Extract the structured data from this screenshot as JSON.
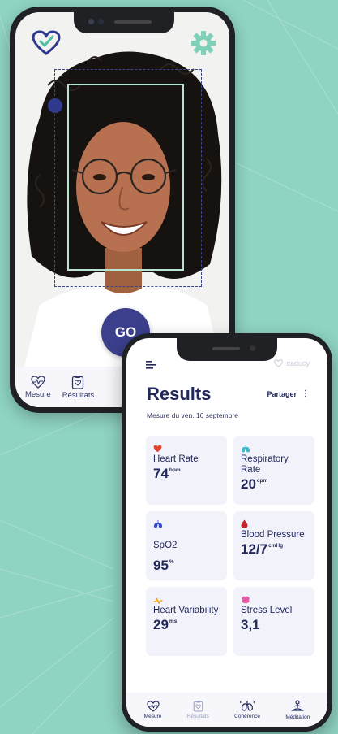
{
  "camera_screen": {
    "go_label": "GO",
    "nav": [
      {
        "label": "Mesure",
        "icon": "heart-pulse-icon"
      },
      {
        "label": "Résultats",
        "icon": "clipboard-heart-icon"
      }
    ]
  },
  "results_screen": {
    "brand": "caducy",
    "title": "Results",
    "share_label": "Partager",
    "more_label": "⋮",
    "subtitle": "Mesure du ven. 16 septembre",
    "cards": [
      {
        "label": "Heart Rate",
        "value": "74",
        "unit": "bpm",
        "icon": "heart-icon",
        "icon_color": "#e0452f"
      },
      {
        "label": "Respiratory Rate",
        "value": "20",
        "unit": "cpm",
        "icon": "lungs-icon",
        "icon_color": "#3fb9c9"
      },
      {
        "label": "SpO2",
        "value": "95",
        "unit": "%",
        "icon": "oxygen-icon",
        "icon_color": "#3a4ccf"
      },
      {
        "label": "Blood Pressure",
        "value": "12/7",
        "unit": "cmHg",
        "icon": "blood-drop-icon",
        "icon_color": "#c0262a"
      },
      {
        "label": "Heart Variability",
        "value": "29",
        "unit": "ms",
        "icon": "wave-icon",
        "icon_color": "#f0a020"
      },
      {
        "label": "Stress Level",
        "value": "3,1",
        "unit": "",
        "icon": "brain-icon",
        "icon_color": "#e65aa5"
      }
    ],
    "nav": [
      {
        "label": "Mesure",
        "icon": "heart-pulse-icon"
      },
      {
        "label": "Résultats",
        "icon": "clipboard-heart-icon"
      },
      {
        "label": "Cohérence",
        "icon": "lungs-outline-icon"
      },
      {
        "label": "Méditation",
        "icon": "meditation-icon"
      }
    ]
  },
  "colors": {
    "background": "#8fd3c3",
    "primary": "#22285a",
    "accent": "#3b3f8c",
    "frame": "#b9e4d6"
  }
}
